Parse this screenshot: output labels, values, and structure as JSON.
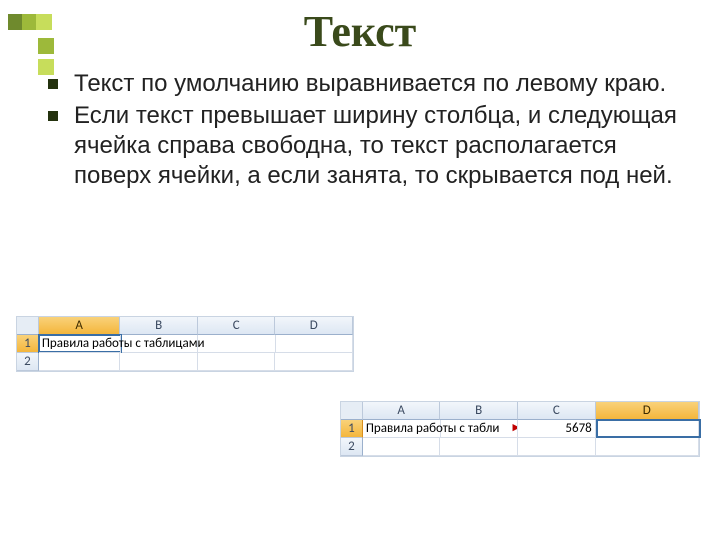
{
  "slide": {
    "title": "Текст",
    "bullets": [
      "Текст по умолчанию выравнивается по левому краю.",
      "Если текст превышает ширину столбца, и следующая ячейка справа свободна, то текст располагается поверх ячейки, а если занята, то скрывается под ней."
    ]
  },
  "sheet1": {
    "columns": [
      "A",
      "B",
      "C",
      "D"
    ],
    "rows": [
      "1",
      "2"
    ],
    "selected_col": "A",
    "selected_row": "1",
    "cells": {
      "A1": "Правила работы с таблицами"
    }
  },
  "sheet2": {
    "columns": [
      "A",
      "B",
      "C",
      "D"
    ],
    "rows": [
      "1",
      "2"
    ],
    "selected_col": "D",
    "selected_row": "1",
    "cells": {
      "A1": "Правила работы с табли",
      "C1": "5678"
    },
    "overflow_marker": "▸"
  }
}
